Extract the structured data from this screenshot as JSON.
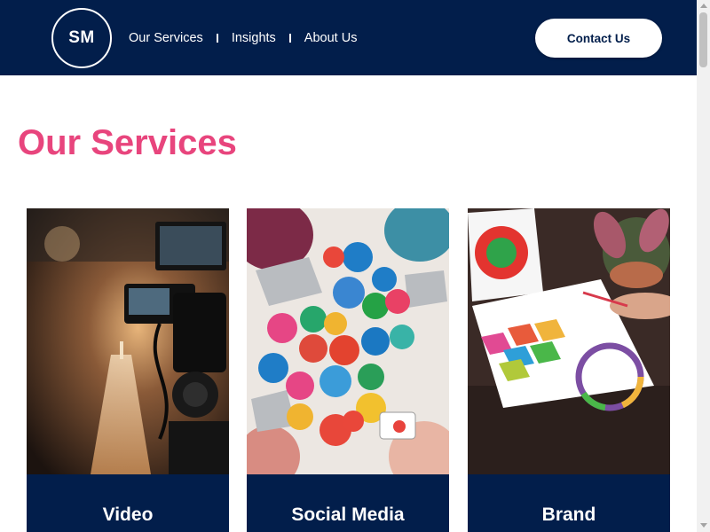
{
  "header": {
    "logo_text": "SM",
    "nav": [
      {
        "label": "Our Services"
      },
      {
        "label": "Insights"
      },
      {
        "label": "About Us"
      }
    ],
    "contact_label": "Contact Us",
    "background_color": "#021e4b"
  },
  "main": {
    "section_title": "Our Services",
    "section_title_color": "#e8457d",
    "cards": [
      {
        "title": "Video",
        "image": "video-camera-photo"
      },
      {
        "title": "Social Media",
        "image": "social-media-icons-photo"
      },
      {
        "title": "Brand",
        "image": "brand-strategy-photo"
      }
    ]
  }
}
